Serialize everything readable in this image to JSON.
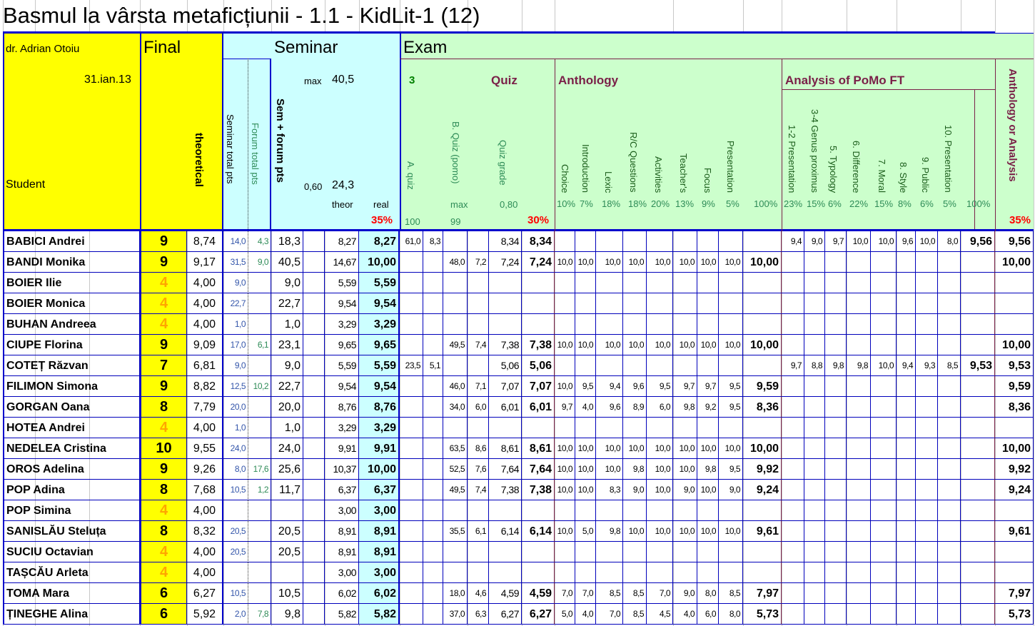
{
  "title": "Basmul la vârsta metaficțiunii - 1.1 - KidLit-1 (12)",
  "header": {
    "author": "dr. Adrian Otoiu",
    "date": "31.ian.13",
    "student": "Student",
    "final": "Final",
    "theoretical": "theoretical",
    "seminar": "Seminar",
    "seminar_total": "Seminar total pts",
    "forum_total": "Forum total pts",
    "sem_forum": "Sem + forum pts",
    "max_label": "max",
    "max_value": "40,5",
    "min_label": "0,60",
    "min_value": "24,3",
    "theor": "theor",
    "real": "real",
    "pct_seminar": "35%",
    "exam": "Exam",
    "quiz_num": "3",
    "quiz": "Quiz",
    "a_quiz": "A. quiz",
    "b_quiz": "B. Quiz (pomo)",
    "quiz_grade": "Quiz grade",
    "quiz_max": "max",
    "quiz_ratio": "0,80",
    "a_max": "100",
    "b_max": "99",
    "pct_quiz": "30%",
    "anthology": "Anthology",
    "anth_cols": [
      "Choice",
      "Introduction",
      "Lexic",
      "R/C Questions",
      "Activities",
      "Teacher's",
      "Focus",
      "Presentation"
    ],
    "anth_pcts": [
      "10%",
      "7%",
      "18%",
      "18%",
      "20%",
      "13%",
      "9%",
      "5%",
      "100%"
    ],
    "analysis": "Analysis of PoMo FT",
    "anal_cols": [
      "1-2 Presentation",
      "3-4 Genus proximus",
      "5. Typology",
      "6. Difference",
      "7. Moral",
      "8. Style",
      "9. Public",
      "10. Presentation"
    ],
    "anal_pcts": [
      "23%",
      "15%",
      "6%",
      "22%",
      "15%",
      "8%",
      "6%",
      "5%",
      "100%"
    ],
    "anth_or_anal": "Anthology or Analysis",
    "pct_exam": "35%"
  },
  "rows": [
    {
      "name": "BABICI Andrei",
      "final": "9",
      "theo": "8,74",
      "sem": "14,0",
      "forum": "4,3",
      "sf": "18,3",
      "theor": "8,27",
      "real": "8,27",
      "qa": "61,0",
      "qa2": "8,3",
      "qb": "",
      "qb2": "",
      "qg": "8,34",
      "qf": "8,34",
      "anth": [
        "",
        "",
        "",
        "",
        "",
        "",
        "",
        ""
      ],
      "anthTotal": "",
      "anal": [
        "9,4",
        "9,0",
        "9,7",
        "10,0",
        "10,0",
        "9,6",
        "10,0",
        "8,0"
      ],
      "analTotal": "9,56",
      "exam": "9,56"
    },
    {
      "name": "BANDI Monika",
      "final": "9",
      "theo": "9,17",
      "sem": "31,5",
      "forum": "9,0",
      "sf": "40,5",
      "theor": "14,67",
      "real": "10,00",
      "qa": "",
      "qa2": "",
      "qb": "48,0",
      "qb2": "7,2",
      "qg": "7,24",
      "qf": "7,24",
      "anth": [
        "10,0",
        "10,0",
        "10,0",
        "10,0",
        "10,0",
        "10,0",
        "10,0",
        "10,0"
      ],
      "anthTotal": "10,00",
      "anal": [
        "",
        "",
        "",
        "",
        "",
        "",
        "",
        ""
      ],
      "analTotal": "",
      "exam": "10,00"
    },
    {
      "name": "BOIER Ilie",
      "final": "4",
      "theo": "4,00",
      "sem": "9,0",
      "forum": "",
      "sf": "9,0",
      "theor": "5,59",
      "real": "5,59",
      "qa": "",
      "qa2": "",
      "qb": "",
      "qb2": "",
      "qg": "",
      "qf": "",
      "anth": [
        "",
        "",
        "",
        "",
        "",
        "",
        "",
        ""
      ],
      "anthTotal": "",
      "anal": [
        "",
        "",
        "",
        "",
        "",
        "",
        "",
        ""
      ],
      "analTotal": "",
      "exam": ""
    },
    {
      "name": "BOIER Monica",
      "final": "4",
      "theo": "4,00",
      "sem": "22,7",
      "forum": "",
      "sf": "22,7",
      "theor": "9,54",
      "real": "9,54",
      "qa": "",
      "qa2": "",
      "qb": "",
      "qb2": "",
      "qg": "",
      "qf": "",
      "anth": [
        "",
        "",
        "",
        "",
        "",
        "",
        "",
        ""
      ],
      "anthTotal": "",
      "anal": [
        "",
        "",
        "",
        "",
        "",
        "",
        "",
        ""
      ],
      "analTotal": "",
      "exam": ""
    },
    {
      "name": "BUHAN Andreea",
      "final": "4",
      "theo": "4,00",
      "sem": "1,0",
      "forum": "",
      "sf": "1,0",
      "theor": "3,29",
      "real": "3,29",
      "qa": "",
      "qa2": "",
      "qb": "",
      "qb2": "",
      "qg": "",
      "qf": "",
      "anth": [
        "",
        "",
        "",
        "",
        "",
        "",
        "",
        ""
      ],
      "anthTotal": "",
      "anal": [
        "",
        "",
        "",
        "",
        "",
        "",
        "",
        ""
      ],
      "analTotal": "",
      "exam": ""
    },
    {
      "name": "CIUPE Florina",
      "final": "9",
      "theo": "9,09",
      "sem": "17,0",
      "forum": "6,1",
      "sf": "23,1",
      "theor": "9,65",
      "real": "9,65",
      "qa": "",
      "qa2": "",
      "qb": "49,5",
      "qb2": "7,4",
      "qg": "7,38",
      "qf": "7,38",
      "anth": [
        "10,0",
        "10,0",
        "10,0",
        "10,0",
        "10,0",
        "10,0",
        "10,0",
        "10,0"
      ],
      "anthTotal": "10,00",
      "anal": [
        "",
        "",
        "",
        "",
        "",
        "",
        "",
        ""
      ],
      "analTotal": "",
      "exam": "10,00"
    },
    {
      "name": "COTEȚ Răzvan",
      "final": "7",
      "theo": "6,81",
      "sem": "9,0",
      "forum": "",
      "sf": "9,0",
      "theor": "5,59",
      "real": "5,59",
      "qa": "23,5",
      "qa2": "5,1",
      "qb": "",
      "qb2": "",
      "qg": "5,06",
      "qf": "5,06",
      "anth": [
        "",
        "",
        "",
        "",
        "",
        "",
        "",
        ""
      ],
      "anthTotal": "",
      "anal": [
        "9,7",
        "8,8",
        "9,8",
        "9,8",
        "10,0",
        "9,4",
        "9,3",
        "8,5"
      ],
      "analTotal": "9,53",
      "exam": "9,53"
    },
    {
      "name": "FILIMON Simona",
      "final": "9",
      "theo": "8,82",
      "sem": "12,5",
      "forum": "10,2",
      "sf": "22,7",
      "theor": "9,54",
      "real": "9,54",
      "qa": "",
      "qa2": "",
      "qb": "46,0",
      "qb2": "7,1",
      "qg": "7,07",
      "qf": "7,07",
      "anth": [
        "10,0",
        "9,5",
        "9,4",
        "9,6",
        "9,5",
        "9,7",
        "9,7",
        "9,5"
      ],
      "anthTotal": "9,59",
      "anal": [
        "",
        "",
        "",
        "",
        "",
        "",
        "",
        ""
      ],
      "analTotal": "",
      "exam": "9,59"
    },
    {
      "name": "GORGAN Oana",
      "final": "8",
      "theo": "7,79",
      "sem": "20,0",
      "forum": "",
      "sf": "20,0",
      "theor": "8,76",
      "real": "8,76",
      "qa": "",
      "qa2": "",
      "qb": "34,0",
      "qb2": "6,0",
      "qg": "6,01",
      "qf": "6,01",
      "anth": [
        "9,7",
        "4,0",
        "9,6",
        "8,9",
        "6,0",
        "9,8",
        "9,2",
        "9,5"
      ],
      "anthTotal": "8,36",
      "anal": [
        "",
        "",
        "",
        "",
        "",
        "",
        "",
        ""
      ],
      "analTotal": "",
      "exam": "8,36"
    },
    {
      "name": "HOTEA Andrei",
      "final": "4",
      "theo": "4,00",
      "sem": "1,0",
      "forum": "",
      "sf": "1,0",
      "theor": "3,29",
      "real": "3,29",
      "qa": "",
      "qa2": "",
      "qb": "",
      "qb2": "",
      "qg": "",
      "qf": "",
      "anth": [
        "",
        "",
        "",
        "",
        "",
        "",
        "",
        ""
      ],
      "anthTotal": "",
      "anal": [
        "",
        "",
        "",
        "",
        "",
        "",
        "",
        ""
      ],
      "analTotal": "",
      "exam": ""
    },
    {
      "name": "NEDELEA Cristina",
      "final": "10",
      "theo": "9,55",
      "sem": "24,0",
      "forum": "",
      "sf": "24,0",
      "theor": "9,91",
      "real": "9,91",
      "qa": "",
      "qa2": "",
      "qb": "63,5",
      "qb2": "8,6",
      "qg": "8,61",
      "qf": "8,61",
      "anth": [
        "10,0",
        "10,0",
        "10,0",
        "10,0",
        "10,0",
        "10,0",
        "10,0",
        "10,0"
      ],
      "anthTotal": "10,00",
      "anal": [
        "",
        "",
        "",
        "",
        "",
        "",
        "",
        ""
      ],
      "analTotal": "",
      "exam": "10,00"
    },
    {
      "name": "OROS Adelina",
      "final": "9",
      "theo": "9,26",
      "sem": "8,0",
      "forum": "17,6",
      "sf": "25,6",
      "theor": "10,37",
      "real": "10,00",
      "qa": "",
      "qa2": "",
      "qb": "52,5",
      "qb2": "7,6",
      "qg": "7,64",
      "qf": "7,64",
      "anth": [
        "10,0",
        "10,0",
        "10,0",
        "9,8",
        "10,0",
        "10,0",
        "9,8",
        "9,5"
      ],
      "anthTotal": "9,92",
      "anal": [
        "",
        "",
        "",
        "",
        "",
        "",
        "",
        ""
      ],
      "analTotal": "",
      "exam": "9,92"
    },
    {
      "name": "POP Adina",
      "final": "8",
      "theo": "7,68",
      "sem": "10,5",
      "forum": "1,2",
      "sf": "11,7",
      "theor": "6,37",
      "real": "6,37",
      "qa": "",
      "qa2": "",
      "qb": "49,5",
      "qb2": "7,4",
      "qg": "7,38",
      "qf": "7,38",
      "anth": [
        "10,0",
        "10,0",
        "8,3",
        "9,0",
        "10,0",
        "9,0",
        "10,0",
        "9,0"
      ],
      "anthTotal": "9,24",
      "anal": [
        "",
        "",
        "",
        "",
        "",
        "",
        "",
        ""
      ],
      "analTotal": "",
      "exam": "9,24"
    },
    {
      "name": "POP Simina",
      "final": "4",
      "theo": "4,00",
      "sem": "",
      "forum": "",
      "sf": "",
      "theor": "3,00",
      "real": "3,00",
      "qa": "",
      "qa2": "",
      "qb": "",
      "qb2": "",
      "qg": "",
      "qf": "",
      "anth": [
        "",
        "",
        "",
        "",
        "",
        "",
        "",
        ""
      ],
      "anthTotal": "",
      "anal": [
        "",
        "",
        "",
        "",
        "",
        "",
        "",
        ""
      ],
      "analTotal": "",
      "exam": ""
    },
    {
      "name": "SANISLĂU Steluța",
      "final": "8",
      "theo": "8,32",
      "sem": "20,5",
      "forum": "",
      "sf": "20,5",
      "theor": "8,91",
      "real": "8,91",
      "qa": "",
      "qa2": "",
      "qb": "35,5",
      "qb2": "6,1",
      "qg": "6,14",
      "qf": "6,14",
      "anth": [
        "10,0",
        "5,0",
        "9,8",
        "10,0",
        "10,0",
        "10,0",
        "10,0",
        "10,0"
      ],
      "anthTotal": "9,61",
      "anal": [
        "",
        "",
        "",
        "",
        "",
        "",
        "",
        ""
      ],
      "analTotal": "",
      "exam": "9,61"
    },
    {
      "name": "SUCIU Octavian",
      "final": "4",
      "theo": "4,00",
      "sem": "20,5",
      "forum": "",
      "sf": "20,5",
      "theor": "8,91",
      "real": "8,91",
      "qa": "",
      "qa2": "",
      "qb": "",
      "qb2": "",
      "qg": "",
      "qf": "",
      "anth": [
        "",
        "",
        "",
        "",
        "",
        "",
        "",
        ""
      ],
      "anthTotal": "",
      "anal": [
        "",
        "",
        "",
        "",
        "",
        "",
        "",
        ""
      ],
      "analTotal": "",
      "exam": ""
    },
    {
      "name": "TAȘCĂU Arleta",
      "final": "4",
      "theo": "4,00",
      "sem": "",
      "forum": "",
      "sf": "",
      "theor": "3,00",
      "real": "3,00",
      "qa": "",
      "qa2": "",
      "qb": "",
      "qb2": "",
      "qg": "",
      "qf": "",
      "anth": [
        "",
        "",
        "",
        "",
        "",
        "",
        "",
        ""
      ],
      "anthTotal": "",
      "anal": [
        "",
        "",
        "",
        "",
        "",
        "",
        "",
        ""
      ],
      "analTotal": "",
      "exam": ""
    },
    {
      "name": "TOMA Mara",
      "final": "6",
      "theo": "6,27",
      "sem": "10,5",
      "forum": "",
      "sf": "10,5",
      "theor": "6,02",
      "real": "6,02",
      "qa": "",
      "qa2": "",
      "qb": "18,0",
      "qb2": "4,6",
      "qg": "4,59",
      "qf": "4,59",
      "anth": [
        "7,0",
        "7,0",
        "8,5",
        "8,5",
        "7,0",
        "9,0",
        "8,0",
        "8,5"
      ],
      "anthTotal": "7,97",
      "anal": [
        "",
        "",
        "",
        "",
        "",
        "",
        "",
        ""
      ],
      "analTotal": "",
      "exam": "7,97"
    },
    {
      "name": "ȚINEGHE Alina",
      "final": "6",
      "theo": "5,92",
      "sem": "2,0",
      "forum": "7,8",
      "sf": "9,8",
      "theor": "5,82",
      "real": "5,82",
      "qa": "",
      "qa2": "",
      "qb": "37,0",
      "qb2": "6,3",
      "qg": "6,27",
      "qf": "6,27",
      "anth": [
        "5,0",
        "4,0",
        "7,0",
        "8,5",
        "4,5",
        "4,0",
        "6,0",
        "8,0"
      ],
      "anthTotal": "5,73",
      "anal": [
        "",
        "",
        "",
        "",
        "",
        "",
        "",
        ""
      ],
      "analTotal": "",
      "exam": "5,73"
    }
  ],
  "colors": {
    "yellow": "#ffff00",
    "cyan": "#ccffff",
    "green": "#ccffcc",
    "blue_border": "#0000cc",
    "maroon": "#7a2048",
    "red": "#ff0000",
    "gold": "#ffa500",
    "grid": "#c8c8c8"
  }
}
